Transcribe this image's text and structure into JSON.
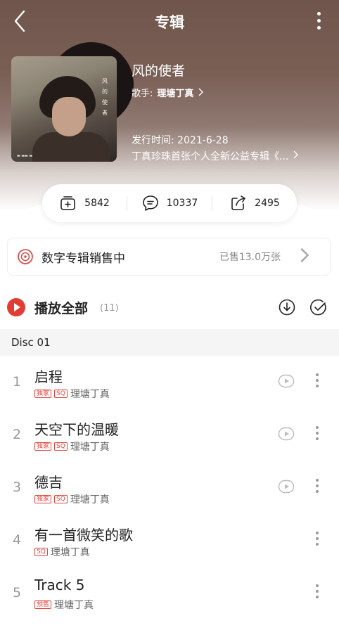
{
  "header": {
    "title": "专辑"
  },
  "album": {
    "cover_text": "风的使者",
    "name": "风的使者",
    "artist_prefix": "歌手:",
    "artist": "理塘丁真",
    "release": "发行时间: 2021-6-28",
    "description": "丁真珍珠首张个人全新公益专辑《..."
  },
  "stats": {
    "collect": "5842",
    "comments": "10337",
    "share": "2495"
  },
  "digital": {
    "label": "数字专辑销售中",
    "sold": "已售13.0万张"
  },
  "playall": {
    "label": "播放全部",
    "count": "(11)"
  },
  "disc": {
    "label": "Disc 01"
  },
  "tracks": [
    {
      "num": "1",
      "name": "启程",
      "badges": [
        "独家",
        "SQ"
      ],
      "artist": "理塘丁真"
    },
    {
      "num": "2",
      "name": "天空下的温暖",
      "badges": [
        "独家",
        "SQ"
      ],
      "artist": "理塘丁真"
    },
    {
      "num": "3",
      "name": "德吉",
      "badges": [
        "独家",
        "SQ"
      ],
      "artist": "理塘丁真"
    },
    {
      "num": "4",
      "name": "有一首微笑的歌",
      "badges": [
        "SQ"
      ],
      "artist": "理塘丁真"
    },
    {
      "num": "5",
      "name": "Track 5",
      "badges": [
        "预售"
      ],
      "artist": "理塘丁真"
    }
  ],
  "colors": {
    "accent": "#e33c33",
    "badge": "#e4453c"
  }
}
